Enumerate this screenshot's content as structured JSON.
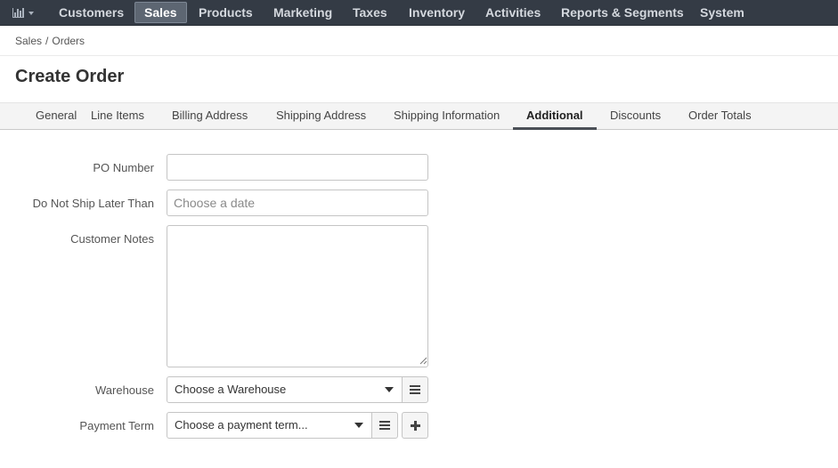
{
  "topnav": {
    "dashboard_icon": "bar-chart-icon",
    "items": [
      {
        "label": "Customers"
      },
      {
        "label": "Sales"
      },
      {
        "label": "Products"
      },
      {
        "label": "Marketing"
      },
      {
        "label": "Taxes"
      },
      {
        "label": "Inventory"
      },
      {
        "label": "Activities"
      },
      {
        "label": "Reports & Segments"
      },
      {
        "label": "System"
      }
    ],
    "active": "Sales"
  },
  "breadcrumb": {
    "items": [
      "Sales",
      "Orders"
    ],
    "separator": "/"
  },
  "page": {
    "title": "Create Order"
  },
  "tabs": {
    "items": [
      {
        "label": "General"
      },
      {
        "label": "Line Items"
      },
      {
        "label": "Billing Address"
      },
      {
        "label": "Shipping Address"
      },
      {
        "label": "Shipping Information"
      },
      {
        "label": "Additional"
      },
      {
        "label": "Discounts"
      },
      {
        "label": "Order Totals"
      }
    ],
    "active": "Additional"
  },
  "form": {
    "po_number": {
      "label": "PO Number",
      "value": "",
      "placeholder": ""
    },
    "ship_date": {
      "label": "Do Not Ship Later Than",
      "value": "",
      "placeholder": "Choose a date"
    },
    "customer_notes": {
      "label": "Customer Notes",
      "value": ""
    },
    "warehouse": {
      "label": "Warehouse",
      "selected": "Choose a Warehouse",
      "list_icon": "list-icon"
    },
    "payment_term": {
      "label": "Payment Term",
      "selected": "Choose a payment term...",
      "list_icon": "list-icon",
      "add_icon": "plus-icon"
    }
  }
}
